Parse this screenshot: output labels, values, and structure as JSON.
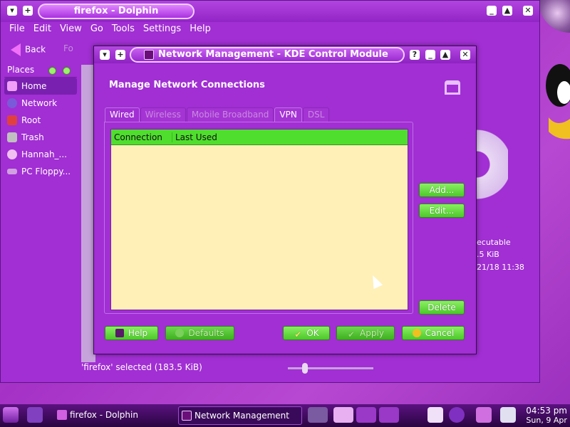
{
  "dolphin": {
    "title": "firefox - Dolphin",
    "menu": [
      "File",
      "Edit",
      "View",
      "Go",
      "Tools",
      "Settings",
      "Help"
    ],
    "toolbar": {
      "back_label": "Back",
      "forward_label": "Fo"
    },
    "places_title": "Places",
    "places": [
      {
        "label": "Home",
        "color": "#f0a0f8"
      },
      {
        "label": "Network",
        "color": "#7a5ad8"
      },
      {
        "label": "Root",
        "color": "#e04040"
      },
      {
        "label": "Trash",
        "color": "#c0c0c0"
      },
      {
        "label": "Hannah_...",
        "color": "#f0c0f0"
      },
      {
        "label": "PC Floppy...",
        "color": "#d0a0e0"
      }
    ],
    "info": {
      "type": "ecutable",
      "size": ".5 KiB",
      "modified": "21/18 11:38"
    },
    "status": "'firefox' selected (183.5 KiB)"
  },
  "dialog": {
    "title": "Network Management - KDE Control Module",
    "heading": "Manage Network Connections",
    "tabs": [
      "Wired",
      "Wireless",
      "Mobile Broadband",
      "VPN",
      "DSL"
    ],
    "columns": [
      "Connection",
      "Last Used"
    ],
    "buttons": {
      "add": "Add...",
      "edit": "Edit...",
      "delete": "Delete",
      "help": "Help",
      "defaults": "Defaults",
      "ok": "OK",
      "apply": "Apply",
      "cancel": "Cancel"
    }
  },
  "taskbar": {
    "tasks": [
      "firefox - Dolphin",
      "Network Management"
    ],
    "time": "04:53 pm",
    "date": "Sun, 9 Apr"
  }
}
